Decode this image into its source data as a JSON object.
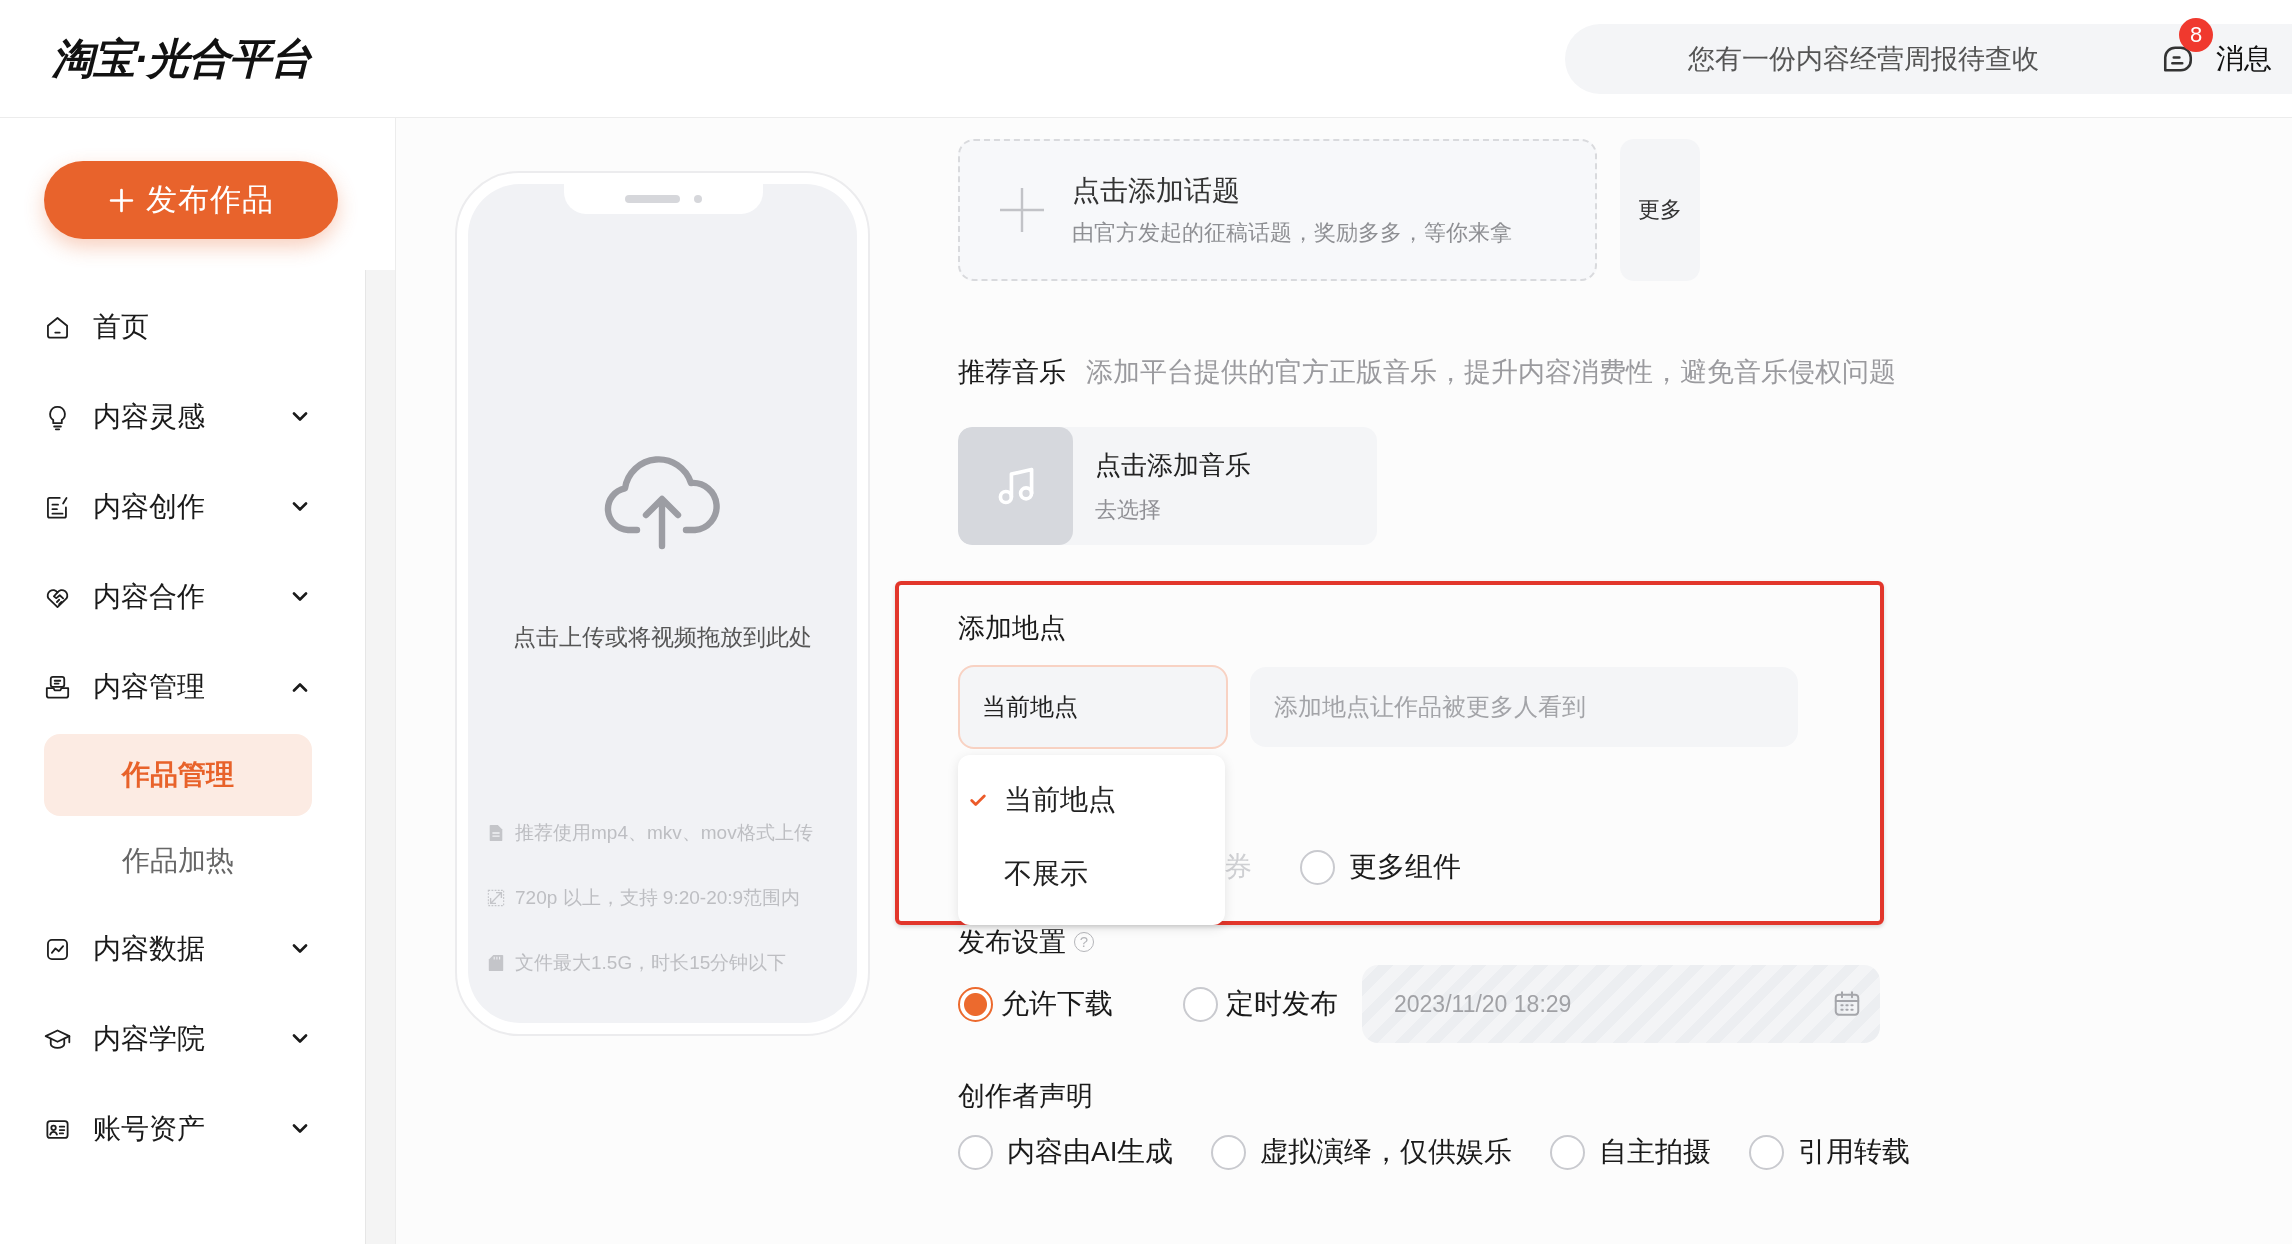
{
  "header": {
    "logo": "淘宝·光合平台",
    "notice": "您有一份内容经营周报待查收",
    "messages": {
      "badge": "8",
      "label": "消息"
    }
  },
  "sidebar": {
    "publish_button": "发布作品",
    "items": [
      {
        "label": "首页",
        "kind": "link"
      },
      {
        "label": "内容灵感",
        "kind": "group",
        "expanded": false
      },
      {
        "label": "内容创作",
        "kind": "group",
        "expanded": false
      },
      {
        "label": "内容合作",
        "kind": "group",
        "expanded": false
      },
      {
        "label": "内容管理",
        "kind": "group",
        "expanded": true,
        "children": [
          {
            "label": "作品管理",
            "selected": true
          },
          {
            "label": "作品加热",
            "selected": false
          }
        ]
      },
      {
        "label": "内容数据",
        "kind": "group",
        "expanded": false
      },
      {
        "label": "内容学院",
        "kind": "group",
        "expanded": false
      },
      {
        "label": "账号资产",
        "kind": "group",
        "expanded": false
      }
    ]
  },
  "upload": {
    "prompt": "点击上传或将视频拖放到此处",
    "hints": [
      "推荐使用mp4、mkv、mov格式上传",
      "720p 以上，支持 9:20-20:9范围内",
      "文件最大1.5G，时长15分钟以下"
    ]
  },
  "topic": {
    "title": "点击添加话题",
    "subtitle": "由官方发起的征稿话题，奖励多多，等你来拿",
    "more_button": "更多"
  },
  "music": {
    "label": "推荐音乐",
    "description": "添加平台提供的官方正版音乐，提升内容消费性，避免音乐侵权问题",
    "card_title": "点击添加音乐",
    "card_action": "去选择"
  },
  "location": {
    "label": "添加地点",
    "select": {
      "value": "当前地点",
      "expanded": true,
      "options": [
        {
          "label": "当前地点",
          "selected": true
        },
        {
          "label": "不展示",
          "selected": false
        }
      ]
    },
    "search": {
      "placeholder": "添加地点让作品被更多人看到"
    }
  },
  "components": {
    "options": [
      {
        "kind": "covered",
        "label": "券"
      },
      {
        "kind": "radio",
        "label": "更多组件",
        "selected": false
      }
    ]
  },
  "publish_settings": {
    "label": "发布设置",
    "help": "?",
    "options": [
      {
        "label": "允许下载",
        "checked": true
      },
      {
        "label": "定时发布",
        "checked": false
      }
    ],
    "schedule": {
      "value": "2023/11/20 18:29",
      "disabled": true
    }
  },
  "creator_statement": {
    "label": "创作者声明",
    "options": [
      {
        "label": "内容由AI生成",
        "selected": false
      },
      {
        "label": "虚拟演绎，仅供娱乐",
        "selected": false
      },
      {
        "label": "自主拍摄",
        "selected": false
      },
      {
        "label": "引用转载",
        "selected": false
      }
    ]
  }
}
